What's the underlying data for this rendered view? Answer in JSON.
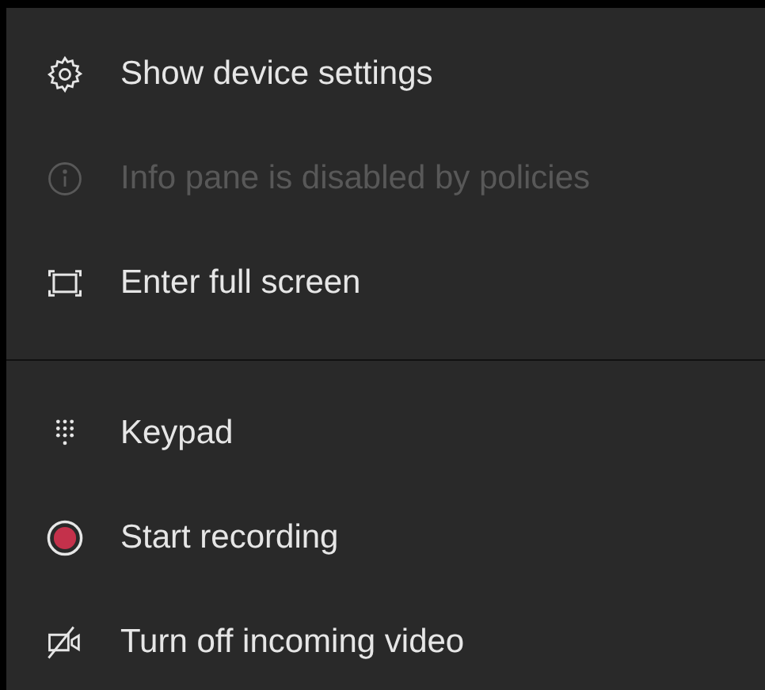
{
  "menu": {
    "groups": [
      {
        "items": [
          {
            "kind": "gear",
            "label": "Show device settings",
            "disabled": false
          },
          {
            "kind": "info",
            "label": "Info pane is disabled by policies",
            "disabled": true
          },
          {
            "kind": "fullscreen",
            "label": "Enter full screen",
            "disabled": false
          }
        ]
      },
      {
        "items": [
          {
            "kind": "keypad",
            "label": "Keypad",
            "disabled": false
          },
          {
            "kind": "record",
            "label": "Start recording",
            "disabled": false
          },
          {
            "kind": "video-off",
            "label": "Turn off incoming video",
            "disabled": false
          }
        ]
      }
    ]
  }
}
